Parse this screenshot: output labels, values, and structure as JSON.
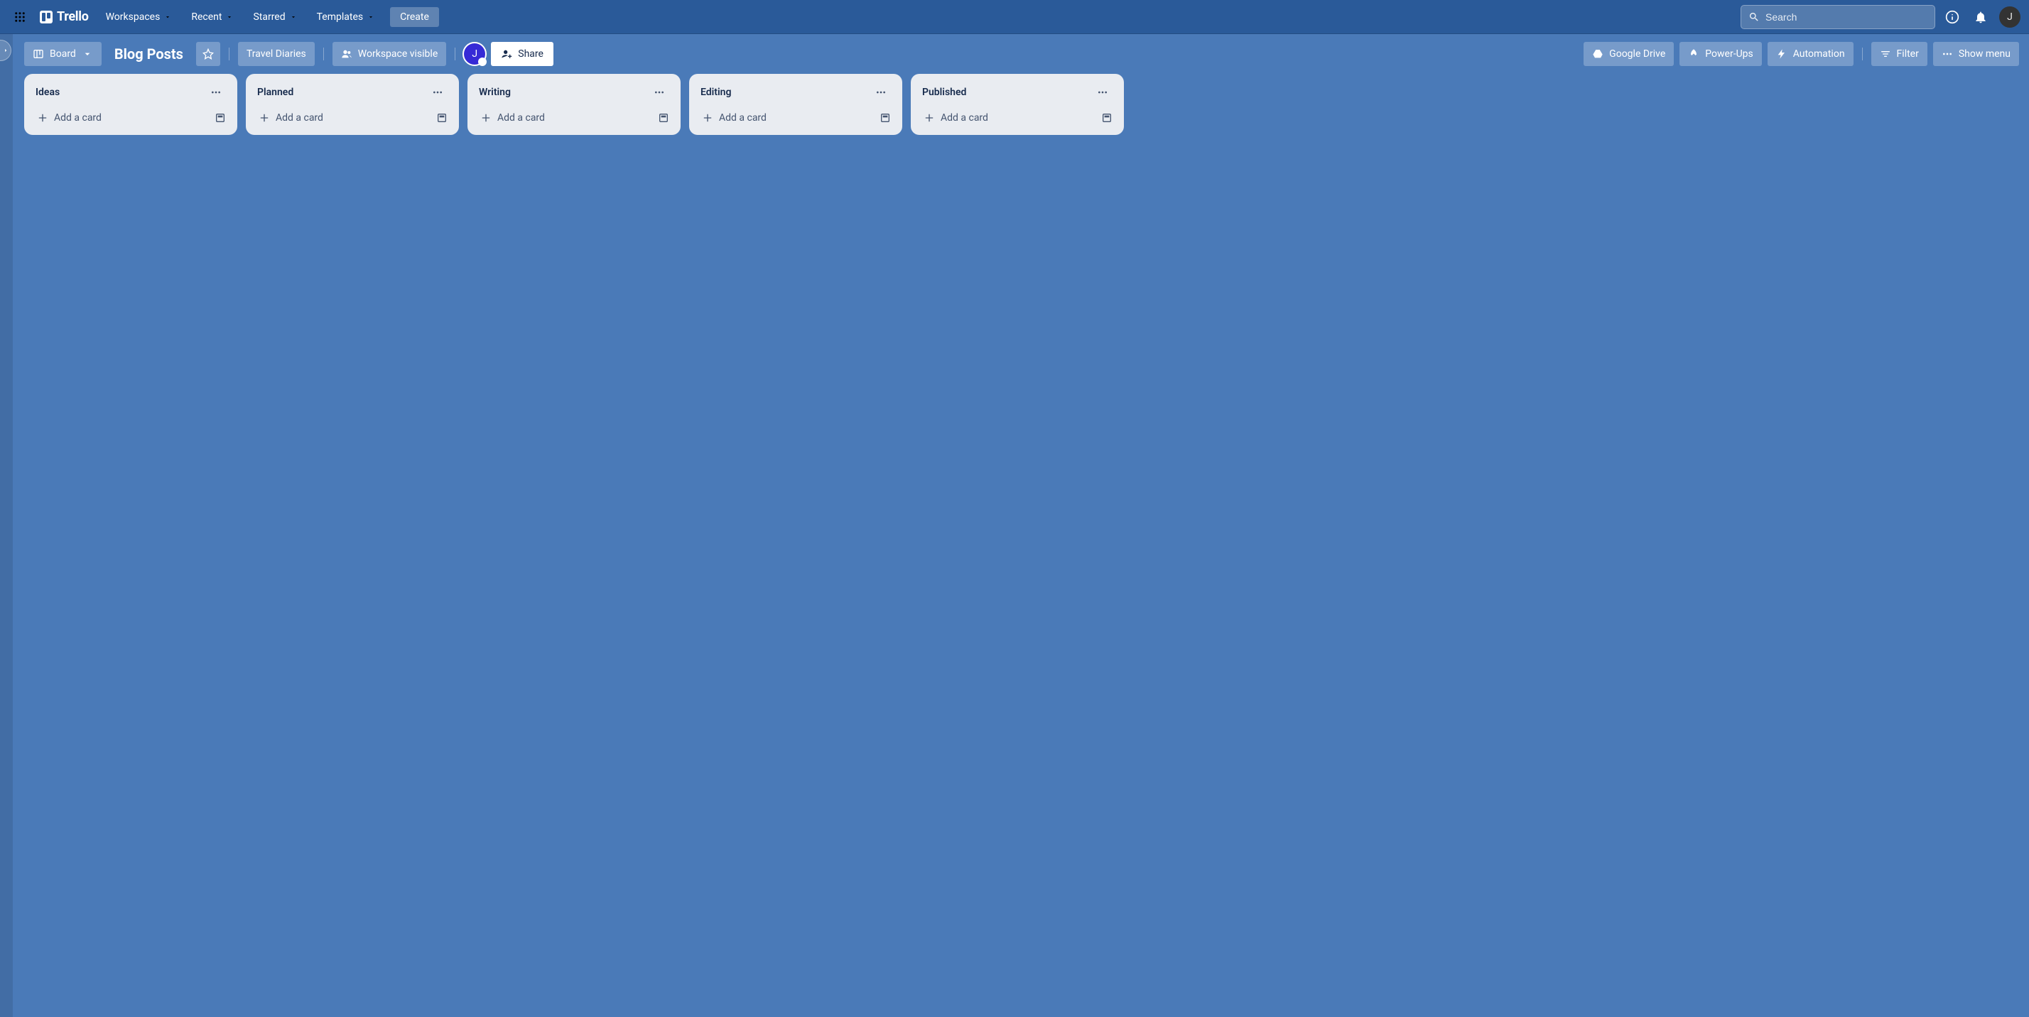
{
  "app": {
    "name": "Trello"
  },
  "nav": {
    "workspaces": "Workspaces",
    "recent": "Recent",
    "starred": "Starred",
    "templates": "Templates",
    "create": "Create"
  },
  "search": {
    "placeholder": "Search"
  },
  "user": {
    "initial": "J"
  },
  "board_bar": {
    "view_button": "Board",
    "title": "Blog Posts",
    "workspace": "Travel Diaries",
    "visibility": "Workspace visible",
    "member_initial": "J",
    "share": "Share",
    "google_drive": "Google Drive",
    "power_ups": "Power-Ups",
    "automation": "Automation",
    "filter": "Filter",
    "show_menu": "Show menu"
  },
  "lists": [
    {
      "title": "Ideas",
      "add_label": "Add a card"
    },
    {
      "title": "Planned",
      "add_label": "Add a card"
    },
    {
      "title": "Writing",
      "add_label": "Add a card"
    },
    {
      "title": "Editing",
      "add_label": "Add a card"
    },
    {
      "title": "Published",
      "add_label": "Add a card"
    }
  ]
}
